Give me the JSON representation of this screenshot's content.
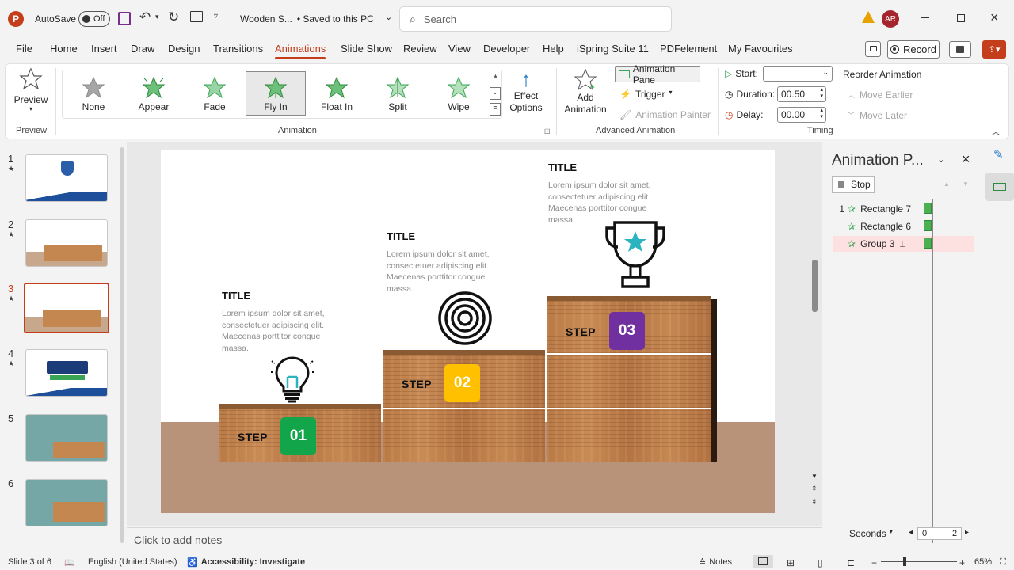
{
  "titlebar": {
    "autosave_label": "AutoSave",
    "autosave_state": "Off",
    "doc_title": "Wooden S...",
    "saved_state": "• Saved to this PC",
    "search_placeholder": "Search",
    "user_initials": "AR"
  },
  "menu": [
    "File",
    "Home",
    "Insert",
    "Draw",
    "Design",
    "Transitions",
    "Animations",
    "Slide Show",
    "Review",
    "View",
    "Developer",
    "Help",
    "iSpring Suite 11",
    "PDFelement",
    "My Favourites"
  ],
  "menu_active": "Animations",
  "record_label": "Record",
  "ribbon": {
    "preview_label": "Preview",
    "preview_group": "Preview",
    "animations": [
      "None",
      "Appear",
      "Fade",
      "Fly In",
      "Float In",
      "Split",
      "Wipe"
    ],
    "selected_animation": "Fly In",
    "animation_group": "Animation",
    "effect_options": "Effect Options",
    "add_animation": "Add Animation",
    "animation_pane_btn": "Animation Pane",
    "trigger": "Trigger",
    "animation_painter": "Animation Painter",
    "advanced_group": "Advanced Animation",
    "start_label": "Start:",
    "start_value": "",
    "duration_label": "Duration:",
    "duration_value": "00.50",
    "delay_label": "Delay:",
    "delay_value": "00.00",
    "timing_group": "Timing",
    "reorder_label": "Reorder Animation",
    "move_earlier": "Move Earlier",
    "move_later": "Move Later"
  },
  "thumbnails": [
    {
      "num": "1",
      "star": "★"
    },
    {
      "num": "2",
      "star": "★"
    },
    {
      "num": "3",
      "star": "★"
    },
    {
      "num": "4",
      "star": "★"
    },
    {
      "num": "5",
      "star": ""
    },
    {
      "num": "6",
      "star": ""
    }
  ],
  "slide": {
    "steps": [
      {
        "title": "TITLE",
        "text": "Lorem ipsum dolor sit amet, consectetuer adipiscing elit. Maecenas porttitor congue massa.",
        "step": "STEP",
        "num": "01",
        "color": "#13a54a"
      },
      {
        "title": "TITLE",
        "text": "Lorem ipsum dolor sit amet, consectetuer adipiscing elit. Maecenas porttitor congue massa.",
        "step": "STEP",
        "num": "02",
        "color": "#ffc000"
      },
      {
        "title": "TITLE",
        "text": "Lorem ipsum dolor sit amet, consectetuer adipiscing elit. Maecenas porttitor congue massa.",
        "step": "STEP",
        "num": "03",
        "color": "#7030a0"
      }
    ]
  },
  "notes_placeholder": "Click to add notes",
  "pane": {
    "title": "Animation P...",
    "stop_label": "Stop",
    "items": [
      {
        "index": "1",
        "name": "Rectangle 7"
      },
      {
        "index": "",
        "name": "Rectangle 6"
      },
      {
        "index": "",
        "name": "Group 3"
      }
    ],
    "seconds_label": "Seconds",
    "timeline_start": "0",
    "timeline_end": "2"
  },
  "status": {
    "slide_info": "Slide 3 of 6",
    "language": "English (United States)",
    "accessibility": "Accessibility: Investigate",
    "notes": "Notes",
    "zoom": "65%"
  },
  "colors": {
    "accent": "#c43e1c",
    "anim_star": "#3aa655",
    "timeline_bar": "#4caf50"
  }
}
